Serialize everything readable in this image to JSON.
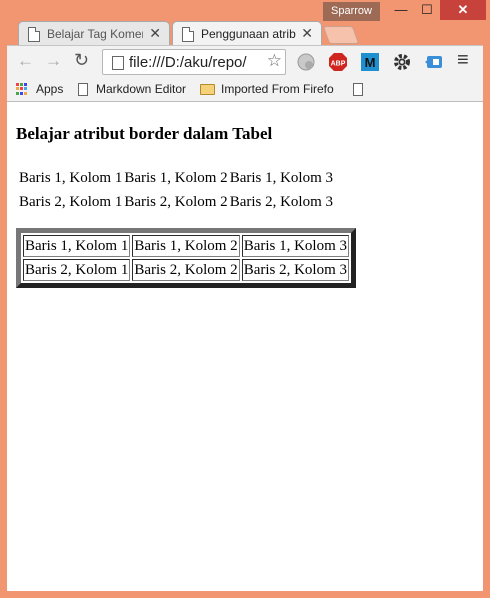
{
  "window": {
    "profile_name": "Sparrow",
    "min_glyph": "—",
    "max_glyph": "☐",
    "close_glyph": "✕"
  },
  "tabs": [
    {
      "title": "Belajar Tag Komer",
      "close": "✕"
    },
    {
      "title": "Penggunaan atrib",
      "close": "✕"
    }
  ],
  "toolbar": {
    "back": "←",
    "forward": "→",
    "reload": "↻",
    "url": "file:///D:/aku/repo/",
    "star": "☆",
    "abp_label": "ABP",
    "m_label": "M",
    "menu": "≡"
  },
  "bookmarks": {
    "items": [
      {
        "label": "Apps"
      },
      {
        "label": "Markdown Editor"
      },
      {
        "label": "Imported From Firefo"
      }
    ]
  },
  "page": {
    "heading": "Belajar atribut border dalam Tabel",
    "table_plain": [
      [
        "Baris 1, Kolom 1",
        "Baris 1, Kolom 2",
        "Baris 1, Kolom 3"
      ],
      [
        "Baris 2, Kolom 1",
        "Baris 2, Kolom 2",
        "Baris 2, Kolom 3"
      ]
    ],
    "table_bordered": [
      [
        "Baris 1, Kolom 1",
        "Baris 1, Kolom 2",
        "Baris 1, Kolom 3"
      ],
      [
        "Baris 2, Kolom 1",
        "Baris 2, Kolom 2",
        "Baris 2, Kolom 3"
      ]
    ]
  },
  "colors": {
    "window_frame": "#f29672",
    "close_button": "#c7423a",
    "abp": "#d0251f",
    "m_ext": "#1f8fcf"
  }
}
